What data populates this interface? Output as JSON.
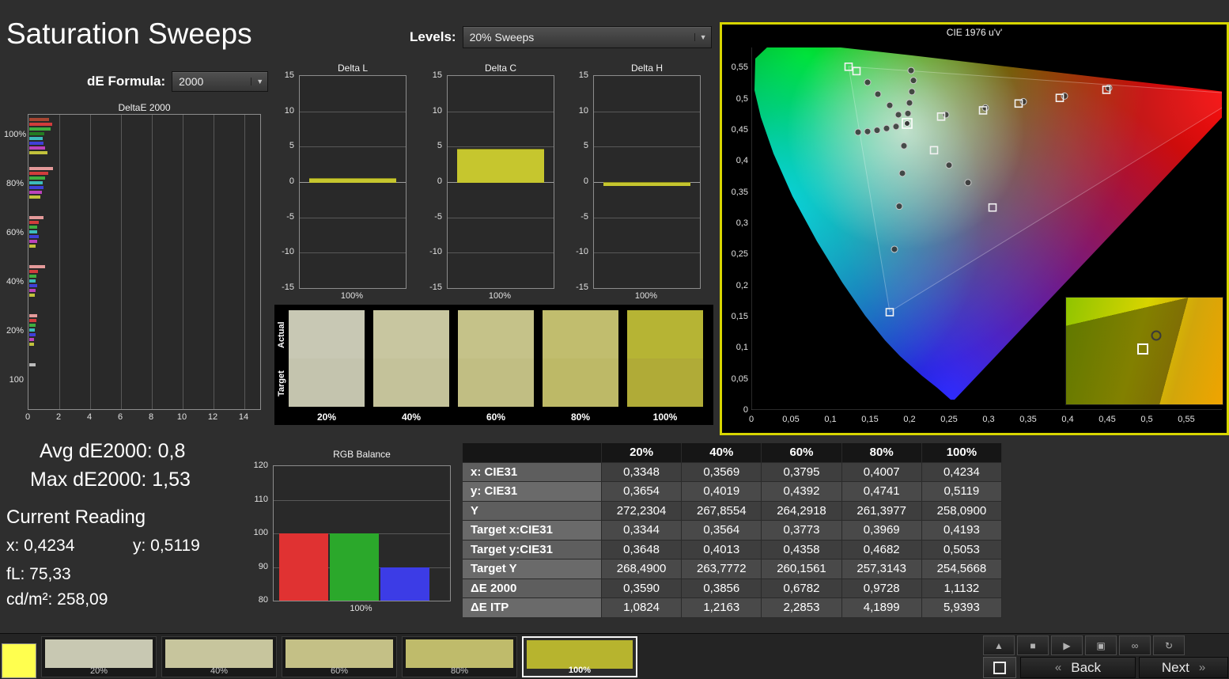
{
  "page": {
    "title": "Saturation Sweeps"
  },
  "controls": {
    "de_formula_label": "dE Formula:",
    "de_formula_value": "2000",
    "levels_label": "Levels:",
    "levels_value": "20% Sweeps"
  },
  "icons": {
    "chevron_down": "▼"
  },
  "readings": {
    "avg": "Avg dE2000: 0,8",
    "max": "Max dE2000: 1,53",
    "current_title": "Current Reading",
    "x": "x: 0,4234",
    "y": "y: 0,5119",
    "fl": "fL: 75,33",
    "cd": "cd/m²: 258,09"
  },
  "chart_data": [
    {
      "id": "deltae2000",
      "type": "bar",
      "title": "DeltaE 2000",
      "orientation": "horizontal",
      "xlim": [
        0,
        14
      ],
      "x_ticks": [
        0,
        2,
        4,
        6,
        8,
        10,
        12,
        14
      ],
      "groups": [
        {
          "label": "100%",
          "bars": [
            {
              "c": "#a84632",
              "v": 1.3
            },
            {
              "c": "#d23c3c",
              "v": 1.5
            },
            {
              "c": "#3fae3f",
              "v": 1.4
            },
            {
              "c": "#237c23",
              "v": 0.95
            },
            {
              "c": "#3cbcbc",
              "v": 0.85
            },
            {
              "c": "#4040d8",
              "v": 0.9
            },
            {
              "c": "#bc42bc",
              "v": 1.05
            },
            {
              "c": "#c2c23c",
              "v": 1.2
            }
          ]
        },
        {
          "label": "80%",
          "bars": [
            {
              "c": "#e49a9a",
              "v": 1.53
            },
            {
              "c": "#d23c3c",
              "v": 1.25
            },
            {
              "c": "#3fae3f",
              "v": 1.0
            },
            {
              "c": "#3cbcbc",
              "v": 0.85
            },
            {
              "c": "#4040d8",
              "v": 0.9
            },
            {
              "c": "#bc42bc",
              "v": 0.8
            },
            {
              "c": "#c2c23c",
              "v": 0.7
            }
          ]
        },
        {
          "label": "60%",
          "bars": [
            {
              "c": "#e49a9a",
              "v": 0.9
            },
            {
              "c": "#d23c3c",
              "v": 0.6
            },
            {
              "c": "#3fae3f",
              "v": 0.5
            },
            {
              "c": "#3cbcbc",
              "v": 0.5
            },
            {
              "c": "#4040d8",
              "v": 0.6
            },
            {
              "c": "#bc42bc",
              "v": 0.5
            },
            {
              "c": "#c2c23c",
              "v": 0.4
            }
          ]
        },
        {
          "label": "40%",
          "bars": [
            {
              "c": "#e49a9a",
              "v": 1.0
            },
            {
              "c": "#d23c3c",
              "v": 0.55
            },
            {
              "c": "#3fae3f",
              "v": 0.45
            },
            {
              "c": "#3cbcbc",
              "v": 0.4
            },
            {
              "c": "#4040d8",
              "v": 0.5
            },
            {
              "c": "#bc42bc",
              "v": 0.4
            },
            {
              "c": "#c2c23c",
              "v": 0.35
            }
          ]
        },
        {
          "label": "20%",
          "bars": [
            {
              "c": "#e49a9a",
              "v": 0.5
            },
            {
              "c": "#d23c3c",
              "v": 0.45
            },
            {
              "c": "#3fae3f",
              "v": 0.4
            },
            {
              "c": "#3cbcbc",
              "v": 0.35
            },
            {
              "c": "#4040d8",
              "v": 0.4
            },
            {
              "c": "#bc42bc",
              "v": 0.3
            },
            {
              "c": "#c2c23c",
              "v": 0.3
            }
          ]
        },
        {
          "label": "100",
          "bars": [
            {
              "c": "#bcbcbc",
              "v": 0.4
            }
          ]
        }
      ]
    },
    {
      "id": "delta_l",
      "type": "bar",
      "title": "Delta L",
      "ylim": [
        -15,
        15
      ],
      "y_ticks": [
        15,
        10,
        5,
        0,
        -5,
        -10,
        -15
      ],
      "categories": [
        "100%"
      ],
      "values": [
        0.6
      ],
      "bar_color": "#c6c62e"
    },
    {
      "id": "delta_c",
      "type": "bar",
      "title": "Delta C",
      "ylim": [
        -15,
        15
      ],
      "y_ticks": [
        15,
        10,
        5,
        0,
        -5,
        -10,
        -15
      ],
      "categories": [
        "100%"
      ],
      "values": [
        4.7
      ],
      "bar_color": "#c6c62e"
    },
    {
      "id": "delta_h",
      "type": "bar",
      "title": "Delta H",
      "ylim": [
        -15,
        15
      ],
      "y_ticks": [
        15,
        10,
        5,
        0,
        -5,
        -10,
        -15
      ],
      "categories": [
        "100%"
      ],
      "values": [
        -0.4
      ],
      "bar_color": "#c6c62e"
    },
    {
      "id": "rgb_balance",
      "type": "bar",
      "title": "RGB Balance",
      "ylim": [
        80,
        120
      ],
      "y_ticks": [
        120,
        110,
        100,
        90,
        80
      ],
      "categories": [
        "100%"
      ],
      "series": [
        {
          "name": "Red",
          "value": 100,
          "color": "#e03232"
        },
        {
          "name": "Green",
          "value": 100,
          "color": "#2ba82b"
        },
        {
          "name": "Blue",
          "value": 90,
          "color": "#3c3ce6"
        }
      ]
    },
    {
      "id": "cie",
      "type": "scatter",
      "title": "CIE 1976 u'v'",
      "xlim": [
        0,
        0.55
      ],
      "ylim": [
        0,
        0.55
      ],
      "x_ticks": [
        {
          "t": "0",
          "v": 0
        },
        {
          "t": "0,05",
          "v": 0.05
        },
        {
          "t": "0,1",
          "v": 0.1
        },
        {
          "t": "0,15",
          "v": 0.15
        },
        {
          "t": "0,2",
          "v": 0.2
        },
        {
          "t": "0,25",
          "v": 0.25
        },
        {
          "t": "0,3",
          "v": 0.3
        },
        {
          "t": "0,35",
          "v": 0.35
        },
        {
          "t": "0,4",
          "v": 0.4
        },
        {
          "t": "0,45",
          "v": 0.45
        },
        {
          "t": "0,5",
          "v": 0.5
        },
        {
          "t": "0,55",
          "v": 0.55
        }
      ],
      "y_ticks": [
        {
          "t": "0,55",
          "v": 0.55
        },
        {
          "t": "0,5",
          "v": 0.5
        },
        {
          "t": "0,45",
          "v": 0.45
        },
        {
          "t": "0,4",
          "v": 0.4
        },
        {
          "t": "0,35",
          "v": 0.35
        },
        {
          "t": "0,3",
          "v": 0.3
        },
        {
          "t": "0,25",
          "v": 0.25
        },
        {
          "t": "0,2",
          "v": 0.2
        },
        {
          "t": "0,15",
          "v": 0.15
        },
        {
          "t": "0,1",
          "v": 0.1
        },
        {
          "t": "0,05",
          "v": 0.05
        },
        {
          "t": "0",
          "v": 0
        }
      ],
      "targets": [
        [
          0.123,
          0.551
        ],
        [
          0.133,
          0.544
        ],
        [
          0.24,
          0.471
        ],
        [
          0.293,
          0.481
        ],
        [
          0.338,
          0.492
        ],
        [
          0.39,
          0.501
        ],
        [
          0.449,
          0.514
        ],
        [
          0.231,
          0.417
        ],
        [
          0.305,
          0.325
        ],
        [
          0.175,
          0.157
        ]
      ],
      "measurements": [
        [
          0.147,
          0.526
        ],
        [
          0.16,
          0.507
        ],
        [
          0.175,
          0.489
        ],
        [
          0.186,
          0.474
        ],
        [
          0.202,
          0.545
        ],
        [
          0.205,
          0.529
        ],
        [
          0.203,
          0.511
        ],
        [
          0.2,
          0.493
        ],
        [
          0.198,
          0.476
        ],
        [
          0.135,
          0.446
        ],
        [
          0.147,
          0.447
        ],
        [
          0.159,
          0.449
        ],
        [
          0.171,
          0.452
        ],
        [
          0.183,
          0.455
        ],
        [
          0.193,
          0.424
        ],
        [
          0.25,
          0.393
        ],
        [
          0.274,
          0.365
        ],
        [
          0.191,
          0.38
        ],
        [
          0.187,
          0.327
        ],
        [
          0.181,
          0.258
        ],
        [
          0.296,
          0.485
        ],
        [
          0.344,
          0.495
        ],
        [
          0.396,
          0.504
        ],
        [
          0.452,
          0.517
        ],
        [
          0.246,
          0.474
        ]
      ],
      "current": [
        0.197,
        0.46
      ],
      "inset": {
        "circle": [
          0.576,
          0.356
        ],
        "square": [
          0.49,
          0.481
        ]
      }
    }
  ],
  "table": {
    "headers": [
      "",
      "20%",
      "40%",
      "60%",
      "80%",
      "100%"
    ],
    "rows": [
      {
        "label": "x: CIE31",
        "values": [
          "0,3348",
          "0,3569",
          "0,3795",
          "0,4007",
          "0,4234"
        ]
      },
      {
        "label": "y: CIE31",
        "values": [
          "0,3654",
          "0,4019",
          "0,4392",
          "0,4741",
          "0,5119"
        ]
      },
      {
        "label": "Y",
        "values": [
          "272,2304",
          "267,8554",
          "264,2918",
          "261,3977",
          "258,0900"
        ]
      },
      {
        "label": "Target x:CIE31",
        "values": [
          "0,3344",
          "0,3564",
          "0,3773",
          "0,3969",
          "0,4193"
        ]
      },
      {
        "label": "Target y:CIE31",
        "values": [
          "0,3648",
          "0,4013",
          "0,4358",
          "0,4682",
          "0,5053"
        ]
      },
      {
        "label": "Target Y",
        "values": [
          "268,4900",
          "263,7772",
          "260,1561",
          "257,3143",
          "254,5668"
        ]
      },
      {
        "label": "ΔE 2000",
        "values": [
          "0,3590",
          "0,3856",
          "0,6782",
          "0,9728",
          "1,1132"
        ]
      },
      {
        "label": "ΔE ITP",
        "values": [
          "1,0824",
          "1,2163",
          "2,2853",
          "4,1899",
          "5,9393"
        ]
      }
    ]
  },
  "swatch_panel": {
    "row_labels": [
      "Actual",
      "Target"
    ],
    "columns": [
      {
        "label": "20%",
        "actual": "#c8c8b4",
        "target": "#c4c4ae"
      },
      {
        "label": "40%",
        "actual": "#c8c6a0",
        "target": "#c4c29a"
      },
      {
        "label": "60%",
        "actual": "#c5c289",
        "target": "#c1be83"
      },
      {
        "label": "80%",
        "actual": "#c1bd6e",
        "target": "#bdb967"
      },
      {
        "label": "100%",
        "actual": "#b6b434",
        "target": "#b0ab37"
      }
    ]
  },
  "bottom_bar": {
    "active_tile_color": "#ffff4f",
    "swatches": [
      {
        "label": "20%",
        "color": "#c8c8b2",
        "selected": false
      },
      {
        "label": "40%",
        "color": "#c7c59d",
        "selected": false
      },
      {
        "label": "60%",
        "color": "#c4c086",
        "selected": false
      },
      {
        "label": "80%",
        "color": "#bfbb6b",
        "selected": false
      },
      {
        "label": "100%",
        "color": "#b7b42e",
        "selected": true
      }
    ],
    "transport": [
      {
        "name": "eject",
        "glyph": "▲"
      },
      {
        "name": "stop",
        "glyph": "■"
      },
      {
        "name": "play",
        "glyph": "▶"
      },
      {
        "name": "record",
        "glyph": "▣"
      },
      {
        "name": "loop",
        "glyph": "∞"
      },
      {
        "name": "refresh",
        "glyph": "↻"
      }
    ],
    "back_arrow": "«",
    "back_label": "Back",
    "next_label": "Next",
    "next_arrow": "»"
  }
}
